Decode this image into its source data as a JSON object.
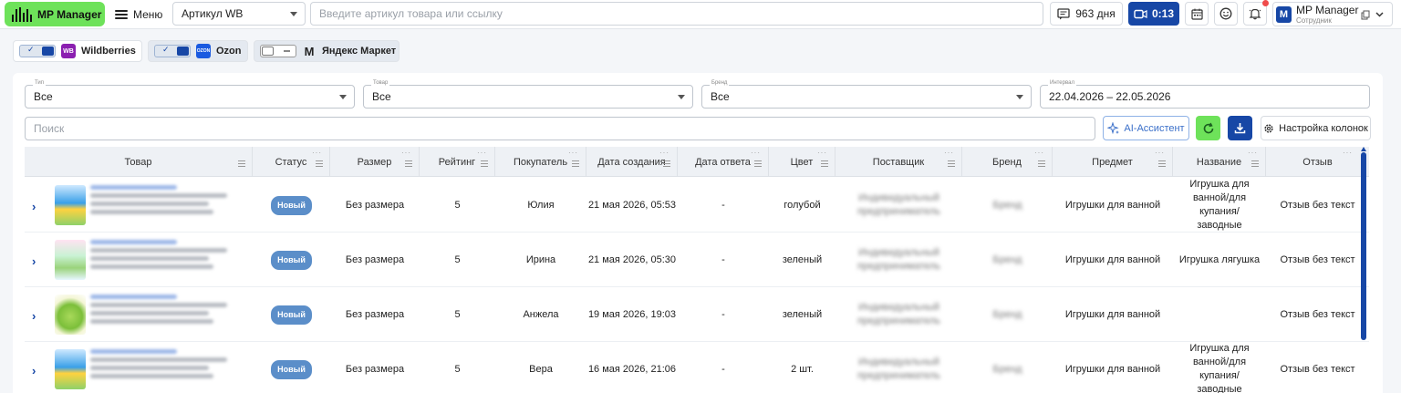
{
  "topbar": {
    "logo": "MP Manager",
    "menu_label": "Меню",
    "article_select": "Артикул WB",
    "search_placeholder": "Введите артикул товара или ссылку",
    "days": "963 дня",
    "timer": "0:13",
    "user_name": "MP Manager",
    "user_role": "Сотрудник",
    "user_initial": "M"
  },
  "marketplaces": [
    {
      "name": "Wildberries",
      "icon_text": "WB",
      "color": "#8b1fb0",
      "enabled": true
    },
    {
      "name": "Ozon",
      "icon_text": "OZON",
      "color": "#1a5ae0",
      "enabled": true
    },
    {
      "name": "Яндекс Маркет",
      "icon_text": "M",
      "color": "#ffcc00",
      "enabled": false
    }
  ],
  "filters": {
    "type": {
      "label": "Тип",
      "value": "Все"
    },
    "product": {
      "label": "Товар",
      "value": "Все"
    },
    "brand": {
      "label": "Бренд",
      "value": "Все"
    },
    "interval": {
      "label": "Интервал",
      "value": "22.04.2026 – 22.05.2026"
    }
  },
  "search_placeholder": "Поиск",
  "buttons": {
    "ai": "AI-Ассистент",
    "columns": "Настройка колонок"
  },
  "table": {
    "columns": [
      "Товар",
      "Статус",
      "Размер",
      "Рейтинг",
      "Покупатель",
      "Дата создания",
      "Дата ответа",
      "Цвет",
      "Поставщик",
      "Бренд",
      "Предмет",
      "Название",
      "Отзыв"
    ],
    "rows": [
      {
        "status": "Новый",
        "size": "Без размера",
        "rating": "5",
        "buyer": "Юлия",
        "created": "21 мая 2026, 05:53",
        "answered": "-",
        "color": "голубой",
        "supplier": "Индивидуальный предприниматель",
        "brand": "Бренд",
        "subject": "Игрушки для ванной",
        "title": "Игрушка для ванной/для купания/заводные",
        "review": "Отзыв без текст"
      },
      {
        "status": "Новый",
        "size": "Без размера",
        "rating": "5",
        "buyer": "Ирина",
        "created": "21 мая 2026, 05:30",
        "answered": "-",
        "color": "зеленый",
        "supplier": "Индивидуальный предприниматель",
        "brand": "Бренд",
        "subject": "Игрушки для ванной",
        "title": "Игрушка лягушка",
        "review": "Отзыв без текст"
      },
      {
        "status": "Новый",
        "size": "Без размера",
        "rating": "5",
        "buyer": "Анжела",
        "created": "19 мая 2026, 19:03",
        "answered": "-",
        "color": "зеленый",
        "supplier": "Индивидуальный предприниматель",
        "brand": "Бренд",
        "subject": "Игрушки для ванной",
        "title": "",
        "review": "Отзыв без текст"
      },
      {
        "status": "Новый",
        "size": "Без размера",
        "rating": "5",
        "buyer": "Вера",
        "created": "16 мая 2026, 21:06",
        "answered": "-",
        "color": "2 шт.",
        "supplier": "Индивидуальный предприниматель",
        "brand": "Бренд",
        "subject": "Игрушки для ванной",
        "title": "Игрушка для ванной/для купания/заводные",
        "review": "Отзыв без текст"
      }
    ]
  }
}
